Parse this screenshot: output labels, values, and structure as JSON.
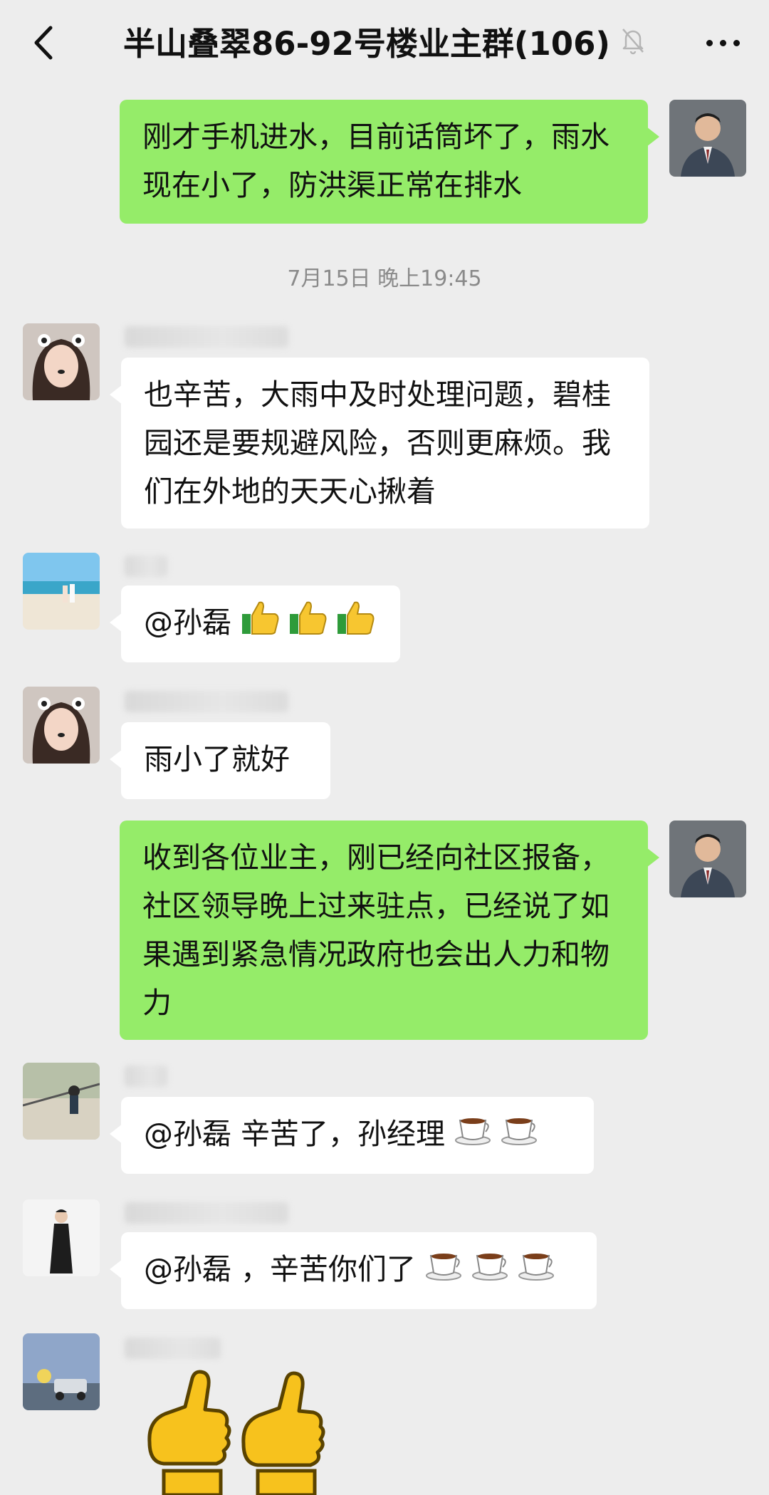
{
  "header": {
    "title": "半山叠翠86-92号楼业主群(106)"
  },
  "messages": [
    {
      "side": "right",
      "text": "刚才手机进水，目前话筒坏了，雨水现在小了，防洪渠正常在排水"
    },
    {
      "type": "timestamp",
      "text": "7月15日 晚上19:45"
    },
    {
      "side": "left",
      "text": "也辛苦，大雨中及时处理问题，碧桂园还是要规避风险，否则更麻烦。我们在外地的天天心揪着"
    },
    {
      "side": "left",
      "text": "@孙磊",
      "emoji": [
        "thumbs-up-icon",
        "thumbs-up-icon",
        "thumbs-up-icon"
      ]
    },
    {
      "side": "left",
      "text": "雨小了就好"
    },
    {
      "side": "right",
      "text": "收到各位业主，刚已经向社区报备，社区领导晚上过来驻点，已经说了如果遇到紧急情况政府也会出人力和物力"
    },
    {
      "side": "left",
      "text": "@孙磊  辛苦了，孙经理",
      "emoji": [
        "coffee-cup-icon",
        "coffee-cup-icon"
      ]
    },
    {
      "side": "left",
      "text": "@孙磊 ，辛苦你们了",
      "emoji": [
        "coffee-cup-icon",
        "coffee-cup-icon",
        "coffee-cup-icon"
      ]
    },
    {
      "side": "left",
      "type": "sticker",
      "sticker": "thumbs-up-sticker"
    }
  ],
  "colors": {
    "background": "#ededed",
    "self_bubble": "#95ec69",
    "other_bubble": "#ffffff",
    "timestamp": "#8a8a8a"
  }
}
